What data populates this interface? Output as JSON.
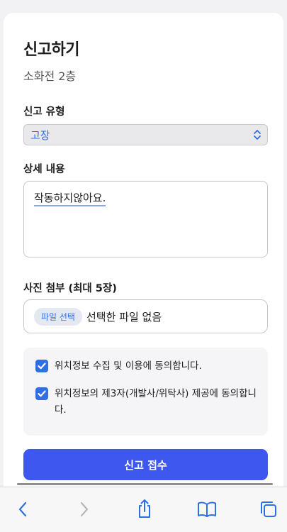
{
  "form": {
    "title": "신고하기",
    "subtitle": "소화전 2층",
    "type_label": "신고 유형",
    "type_value": "고장",
    "detail_label": "상세 내용",
    "detail_value": "작동하지않아요.",
    "photo_label": "사진 첨부 (최대 5장)",
    "file_button": "파일 선택",
    "file_status": "선택한 파일 없음",
    "consents": [
      {
        "text": "위치정보 수집 및 이용에 동의합니다.",
        "checked": true
      },
      {
        "text": "위치정보의 제3자(개발사/위탁사) 제공에 동의합니다.",
        "checked": true
      }
    ],
    "submit_label": "신고 접수"
  },
  "toolbar": {
    "items": [
      "back-icon",
      "forward-icon",
      "share-icon",
      "bookmarks-icon",
      "tabs-icon"
    ]
  },
  "colors": {
    "accent": "#2f6fe4",
    "submit": "#3d57ef"
  }
}
